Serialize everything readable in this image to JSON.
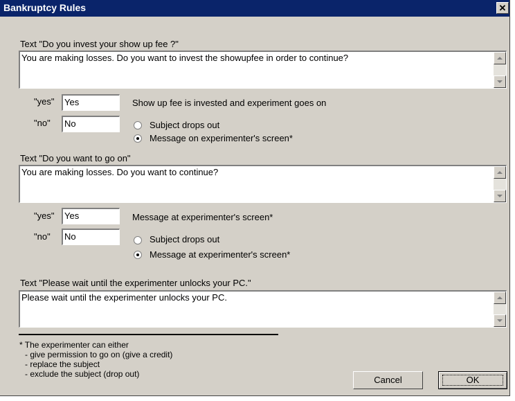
{
  "window": {
    "title": "Bankruptcy Rules",
    "close_glyph": "✕"
  },
  "section1": {
    "label": "Text \"Do you invest your show up fee ?\"",
    "text": "You are making losses. Do you want to invest the showupfee in order to continue?",
    "yes_label": "\"yes\"",
    "yes_value": "Yes",
    "yes_desc": "Show up fee is invested and experiment goes on",
    "no_label": "\"no\"",
    "no_value": "No",
    "options": [
      "Subject drops out",
      "Message on experimenter's screen*"
    ],
    "selected_option": 1
  },
  "section2": {
    "label": "Text \"Do you want to go on\"",
    "text": "You are making losses. Do you want to continue?",
    "yes_label": "\"yes\"",
    "yes_value": "Yes",
    "yes_desc": "Message at experimenter's screen*",
    "no_label": "\"no\"",
    "no_value": "No",
    "options": [
      "Subject drops out",
      "Message at experimenter's screen*"
    ],
    "selected_option": 1
  },
  "section3": {
    "label": "Text \"Please wait until the experimenter unlocks your PC.\"",
    "text": "Please wait until the experimenter unlocks your PC."
  },
  "footnote": {
    "lines": [
      "* The experimenter can either",
      "  - give permission to go on (give a credit)",
      "  - replace the subject",
      "  - exclude the subject (drop out)"
    ]
  },
  "buttons": {
    "cancel": "Cancel",
    "ok": "OK"
  },
  "colors": {
    "titlebar": "#0a246a",
    "face": "#d4d0c8"
  }
}
